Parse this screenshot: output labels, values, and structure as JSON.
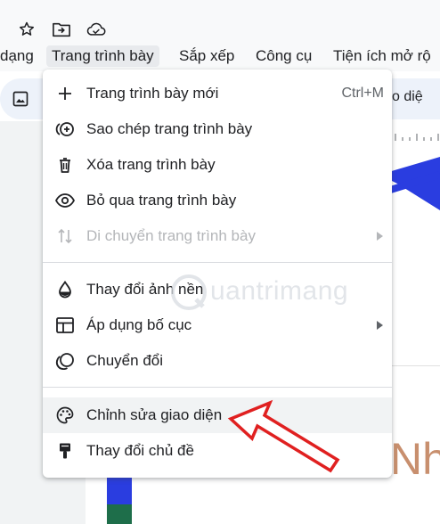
{
  "menubar": {
    "items": [
      "dạng",
      "Trang trình bày",
      "Sắp xếp",
      "Công cụ",
      "Tiện ích mở rộ"
    ],
    "active_index": 1
  },
  "top_icons": [
    "star-icon",
    "move-to-folder-icon",
    "cloud-saved-icon"
  ],
  "toolbar": {
    "partial_text": "o diệ",
    "image_icon": "image-icon"
  },
  "slide": {
    "big_text": "Nh"
  },
  "dropdown": {
    "groups": [
      [
        {
          "icon": "plus-icon",
          "label": "Trang trình bày mới",
          "shortcut": "Ctrl+M",
          "disabled": false,
          "submenu": false
        },
        {
          "icon": "duplicate-icon",
          "label": "Sao chép trang trình bày",
          "shortcut": "",
          "disabled": false,
          "submenu": false
        },
        {
          "icon": "trash-icon",
          "label": "Xóa trang trình bày",
          "shortcut": "",
          "disabled": false,
          "submenu": false
        },
        {
          "icon": "eye-icon",
          "label": "Bỏ qua trang trình bày",
          "shortcut": "",
          "disabled": false,
          "submenu": false
        },
        {
          "icon": "move-arrows-icon",
          "label": "Di chuyển trang trình bày",
          "shortcut": "",
          "disabled": true,
          "submenu": true
        }
      ],
      [
        {
          "icon": "background-drop-icon",
          "label": "Thay đổi ảnh nền",
          "shortcut": "",
          "disabled": false,
          "submenu": false
        },
        {
          "icon": "layout-icon",
          "label": "Áp dụng bố cục",
          "shortcut": "",
          "disabled": false,
          "submenu": true
        },
        {
          "icon": "transition-icon",
          "label": "Chuyển đổi",
          "shortcut": "",
          "disabled": false,
          "submenu": false
        }
      ],
      [
        {
          "icon": "palette-icon",
          "label": "Chỉnh sửa giao diện",
          "shortcut": "",
          "disabled": false,
          "submenu": false,
          "highlighted": true
        },
        {
          "icon": "paint-roller-icon",
          "label": "Thay đổi chủ đề",
          "shortcut": "",
          "disabled": false,
          "submenu": false
        }
      ]
    ]
  },
  "watermark": {
    "text": "uantrimang",
    "logo": "quantrimang-logo"
  },
  "annotation": {
    "type": "red-arrow",
    "points_to": "Chỉnh sửa giao diện"
  },
  "colors": {
    "menubar_bg": "#f8f9fa",
    "toolbar_bg": "#edf2fa",
    "menu_hover": "#f1f3f4",
    "disabled_text": "#b4b6b9",
    "slide_blue": "#2a3de0",
    "slide_green": "#1e6e4a",
    "annotation_red": "#e02020",
    "slide_text": "#c88f6e"
  }
}
